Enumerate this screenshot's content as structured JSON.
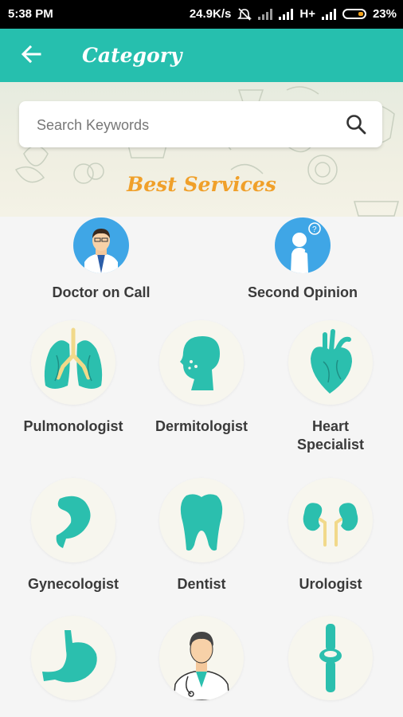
{
  "status": {
    "time": "5:38 PM",
    "speed": "24.9K/s",
    "network": "H+",
    "battery": "23%"
  },
  "appbar": {
    "title": "Category"
  },
  "search": {
    "placeholder": "Search Keywords"
  },
  "banner": {
    "heading": "Best Services"
  },
  "top_services": [
    {
      "label": "Doctor on Call",
      "icon": "doctor-avatar-icon"
    },
    {
      "label": "Second Opinion",
      "icon": "second-opinion-icon"
    }
  ],
  "categories": [
    {
      "label": "Pulmonologist",
      "icon": "lungs-icon"
    },
    {
      "label": "Dermitologist",
      "icon": "face-icon"
    },
    {
      "label_line1": "Heart",
      "label_line2": "Specialist",
      "icon": "heart-icon"
    },
    {
      "label": "Gynecologist",
      "icon": "uterus-icon"
    },
    {
      "label": "Dentist",
      "icon": "tooth-icon"
    },
    {
      "label": "Urologist",
      "icon": "kidneys-icon"
    },
    {
      "label": "",
      "icon": "stomach-icon"
    },
    {
      "label": "",
      "icon": "doctor-icon"
    },
    {
      "label": "",
      "icon": "bone-joint-icon"
    }
  ],
  "colors": {
    "primary": "#26bfae",
    "accent": "#f0a02a",
    "icon_teal": "#2bbfae",
    "icon_blue": "#3fa6e6"
  }
}
